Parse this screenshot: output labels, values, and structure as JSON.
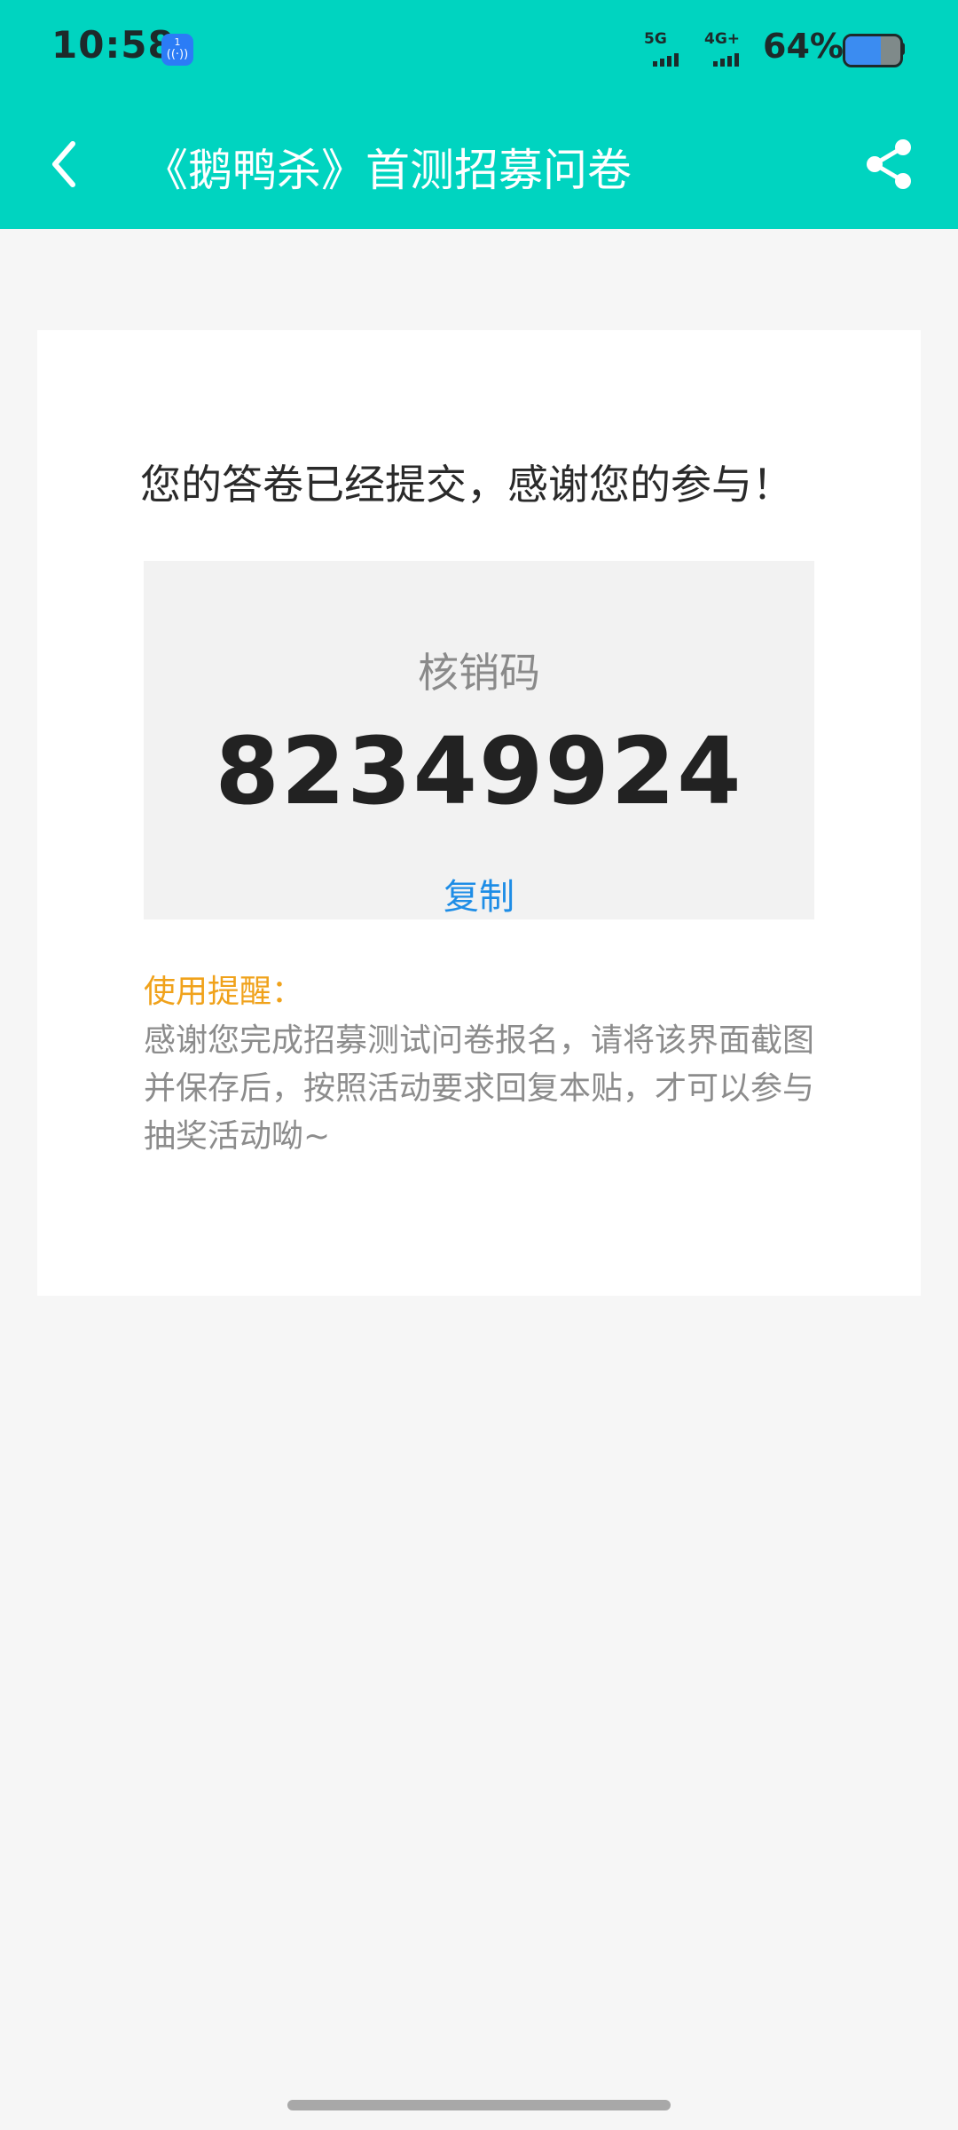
{
  "status_bar": {
    "time": "10:58",
    "hotspot_count": "1",
    "hotspot_icon": "((·))",
    "signal1_label": "5G",
    "signal2_label": "4G+",
    "battery_percent": "64%",
    "battery_level": 0.64
  },
  "nav": {
    "title": "《鹅鸭杀》首测招募问卷",
    "back_icon": "chevron-left-icon",
    "share_icon": "share-icon"
  },
  "card": {
    "thanks": "您的答卷已经提交，感谢您的参与！",
    "code_label": "核销码",
    "code_value": "82349924",
    "copy_label": "复制",
    "reminder_title": "使用提醒：",
    "reminder_text": "感谢您完成招募测试问卷报名，请将该界面截图并保存后，按照活动要求回复本贴，才可以参与抽奖活动呦~"
  },
  "colors": {
    "header": "#00d4c0",
    "accent_link": "#1e8de6",
    "reminder_title": "#f0a21b",
    "background": "#f6f6f6"
  }
}
